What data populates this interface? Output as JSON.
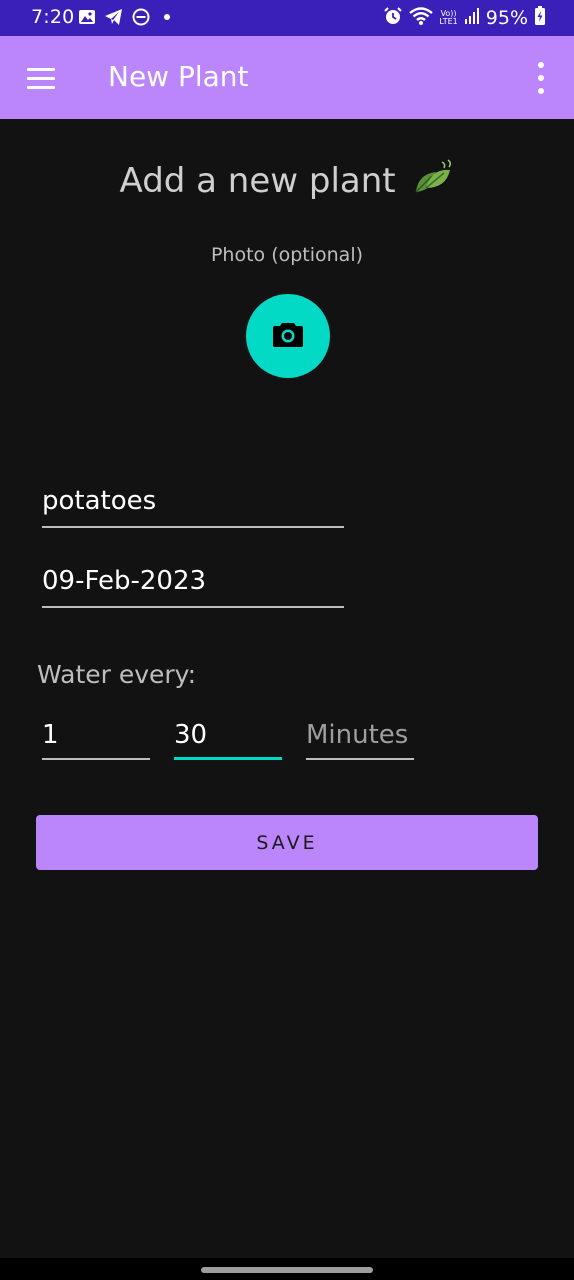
{
  "status_bar": {
    "time": "7:20",
    "battery": "95%",
    "network_label_top": "Vo))",
    "network_label_bottom": "LTE1",
    "left_icons": [
      "image-icon",
      "telegram-icon",
      "do-not-disturb-icon",
      "dot-icon"
    ],
    "right_icons": [
      "alarm-icon",
      "wifi-icon",
      "signal-icon",
      "battery-charging-icon"
    ]
  },
  "app_bar": {
    "title": "New Plant",
    "menu_icon": "hamburger-menu-icon",
    "overflow_icon": "more-vert-icon",
    "color": "#bb86fc"
  },
  "form": {
    "heading": "Add a new plant",
    "heading_icon": "leaves-icon",
    "photo_label": "Photo (optional)",
    "photo_icon": "camera-icon",
    "name_value": "potatoes",
    "date_value": "09-Feb-2023",
    "water_label": "Water every:",
    "interval_hours": "1",
    "interval_minutes": "30",
    "interval_unit": "Minutes",
    "save_label": "SAVE"
  },
  "colors": {
    "accent": "#03dac5",
    "primary": "#bb86fc",
    "background": "#121212",
    "status_bar": "#3a1fb8"
  }
}
